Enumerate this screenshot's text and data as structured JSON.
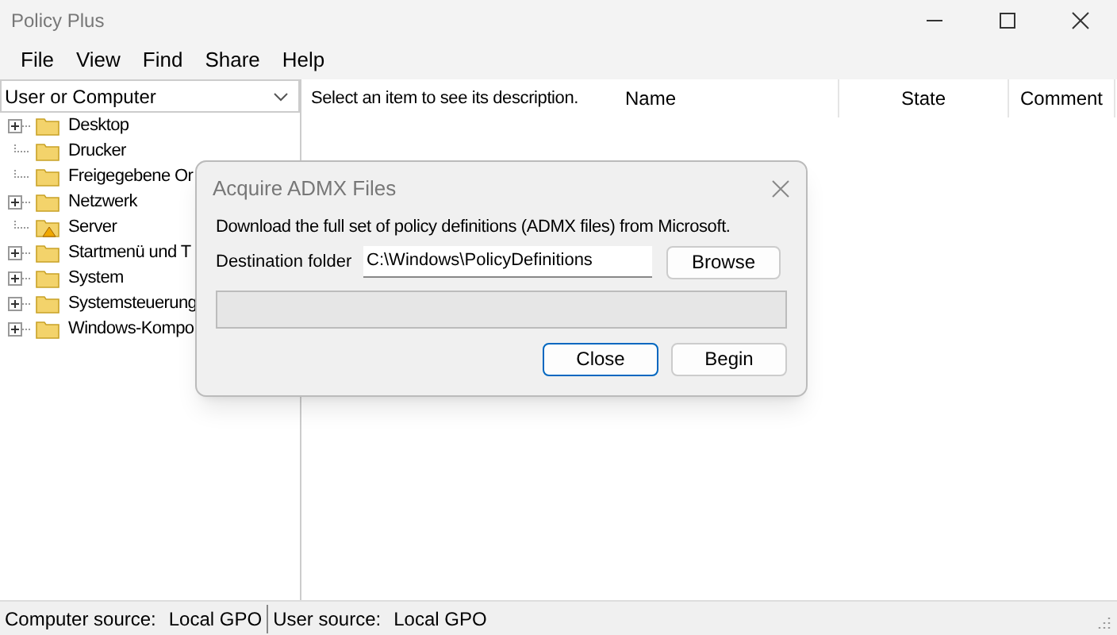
{
  "window": {
    "title": "Policy Plus"
  },
  "menu": [
    "File",
    "View",
    "Find",
    "Share",
    "Help"
  ],
  "scope_dropdown": {
    "value": "User or Computer"
  },
  "tree": [
    {
      "label": "Desktop",
      "expandable": true,
      "kind": "folder"
    },
    {
      "label": "Drucker",
      "expandable": false,
      "kind": "folder"
    },
    {
      "label": "Freigegebene Or",
      "expandable": false,
      "kind": "folder"
    },
    {
      "label": "Netzwerk",
      "expandable": true,
      "kind": "folder"
    },
    {
      "label": "Server",
      "expandable": false,
      "kind": "warning-folder"
    },
    {
      "label": "Startmenü und T",
      "expandable": true,
      "kind": "folder"
    },
    {
      "label": "System",
      "expandable": true,
      "kind": "folder"
    },
    {
      "label": "Systemsteuerung",
      "expandable": true,
      "kind": "folder"
    },
    {
      "label": "Windows-Kompo",
      "expandable": true,
      "kind": "folder"
    }
  ],
  "description": "Select an item to see its description.",
  "table": {
    "columns": [
      "Name",
      "State",
      "Comment"
    ]
  },
  "dialog": {
    "title": "Acquire ADMX Files",
    "message": "Download the full set of policy definitions (ADMX files) from Microsoft.",
    "folder_label": "Destination folder",
    "folder_value": "C:\\Windows\\PolicyDefinitions",
    "browse": "Browse",
    "progress": {
      "level": 0
    },
    "buttons": [
      {
        "label": "Close",
        "default": true
      },
      {
        "label": "Begin",
        "default": false
      }
    ]
  },
  "status_bar": [
    {
      "label": "Computer source:",
      "value": "Local GPO"
    },
    {
      "label": "User source:",
      "value": "Local GPO"
    }
  ]
}
